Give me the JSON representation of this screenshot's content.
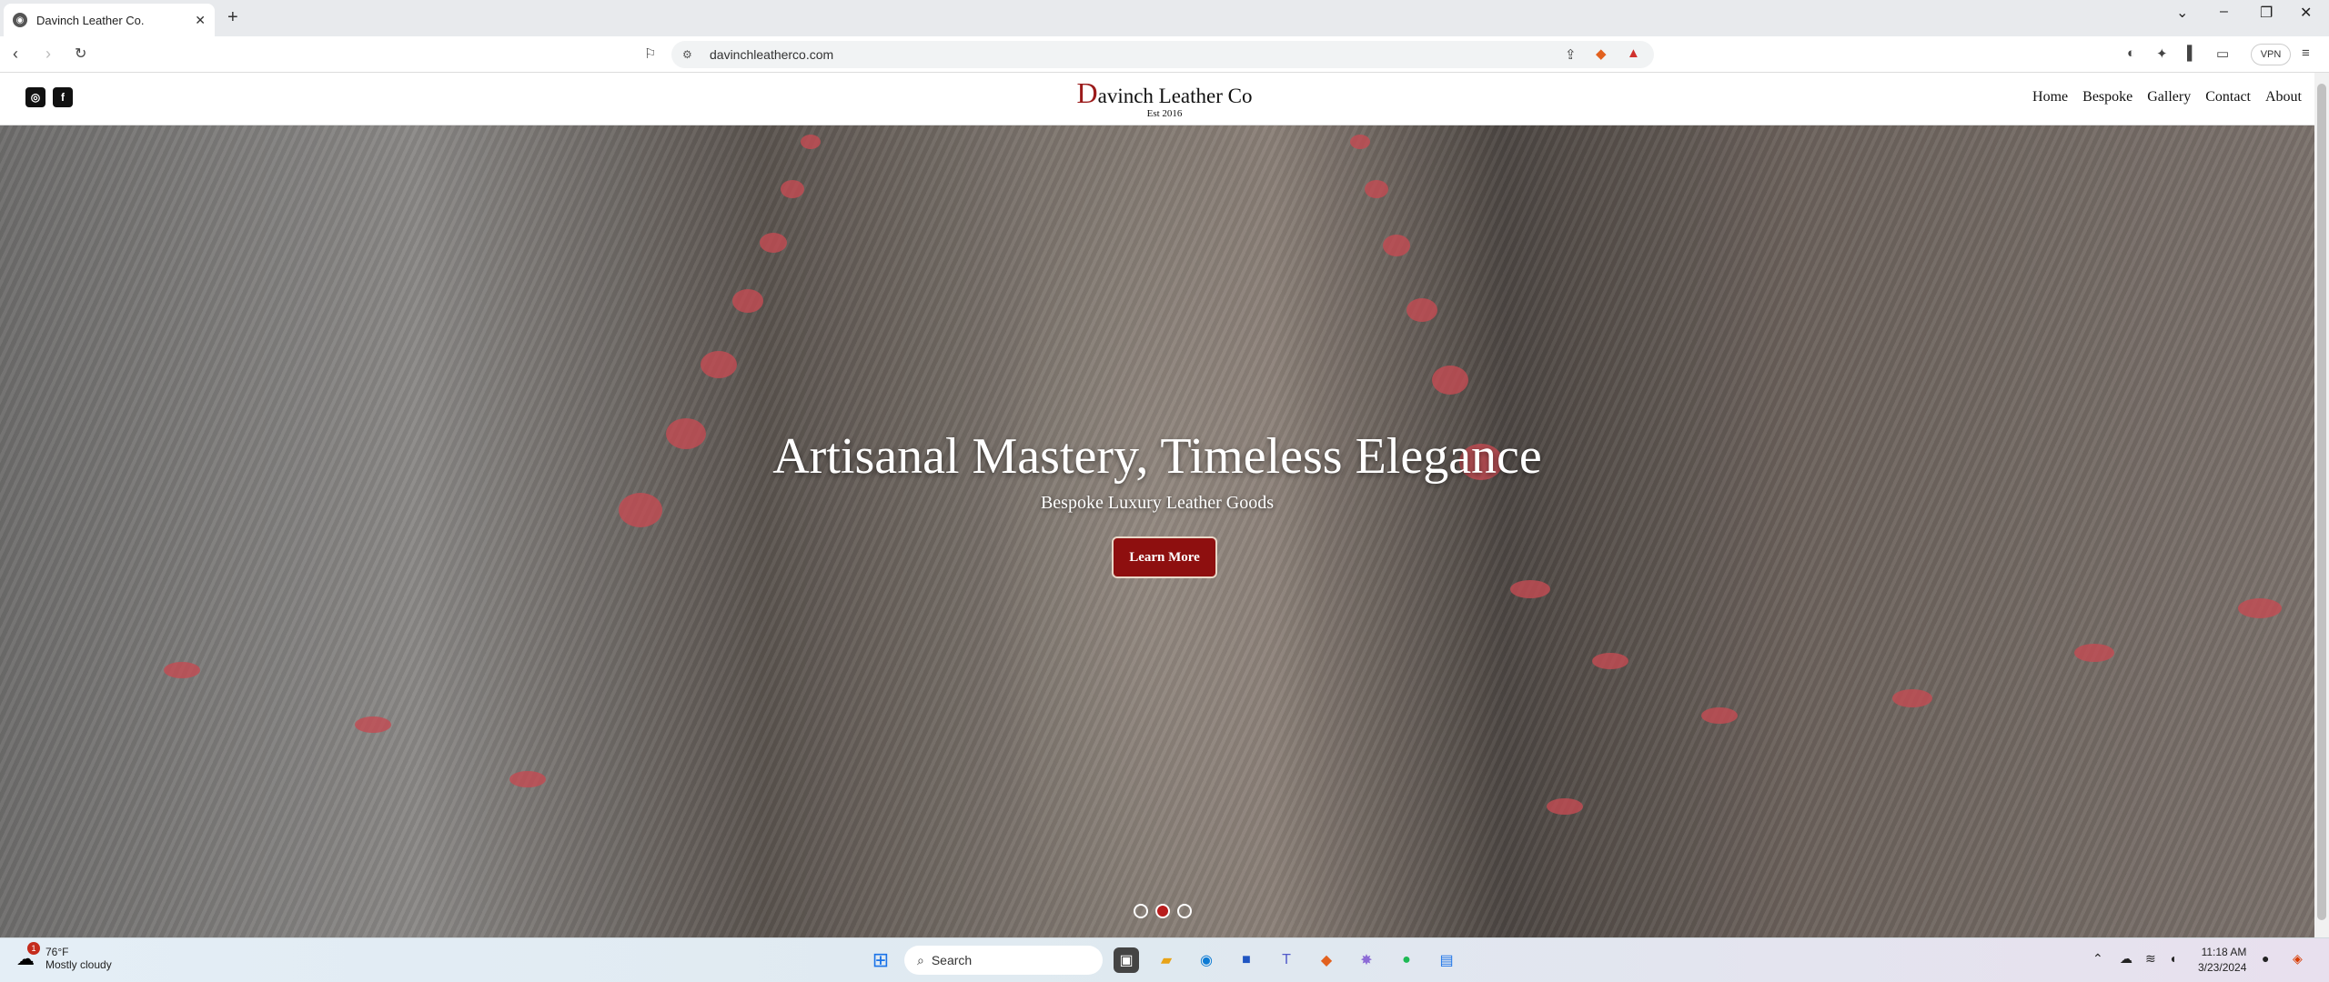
{
  "browser": {
    "tab_title": "Davinch Leather Co.",
    "tab_close": "✕",
    "new_tab": "+",
    "url": "davinchleatherco.com",
    "vpn_label": "VPN",
    "window_controls": {
      "list": "⌄",
      "minimize": "–",
      "restore": "❐",
      "close": "✕"
    }
  },
  "site": {
    "brand_initial": "D",
    "brand_rest": "avinch Leather Co",
    "est": "Est 2016",
    "social": [
      {
        "icon": "instagram-icon",
        "glyph": "◎"
      },
      {
        "icon": "facebook-icon",
        "glyph": "f"
      }
    ],
    "nav": [
      "Home",
      "Bespoke",
      "Gallery",
      "Contact",
      "About"
    ]
  },
  "hero": {
    "title": "Artisanal Mastery, Timeless Elegance",
    "subtitle": "Bespoke Luxury Leather Goods",
    "cta": "Learn More",
    "slides": 3,
    "active_slide": 2,
    "accent_color": "#8e0f0f"
  },
  "taskbar": {
    "weather_temp": "76°F",
    "weather_desc": "Mostly cloudy",
    "weather_badge": "1",
    "search_label": "Search",
    "time": "11:18 AM",
    "date": "3/23/2024"
  }
}
